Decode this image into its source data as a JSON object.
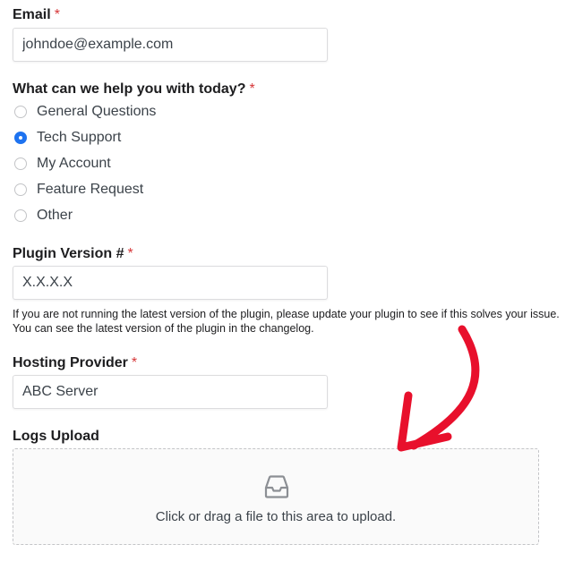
{
  "email": {
    "label": "Email",
    "required_mark": "*",
    "placeholder": "johndoe@example.com"
  },
  "help_topic": {
    "label": "What can we help you with today?",
    "required_mark": "*",
    "options": [
      {
        "label": "General Questions",
        "checked": false
      },
      {
        "label": "Tech Support",
        "checked": true
      },
      {
        "label": "My Account",
        "checked": false
      },
      {
        "label": "Feature Request",
        "checked": false
      },
      {
        "label": "Other",
        "checked": false
      }
    ],
    "selected": "Tech Support"
  },
  "plugin_version": {
    "label": "Plugin Version #",
    "required_mark": "*",
    "placeholder": "X.X.X.X",
    "description": "If you are not running the latest version of the plugin, please update your plugin to see if this solves your issue. You can see the latest version of the plugin in the changelog."
  },
  "hosting_provider": {
    "label": "Hosting Provider",
    "required_mark": "*",
    "value": "ABC Server"
  },
  "logs_upload": {
    "label": "Logs Upload",
    "dropzone_text": "Click or drag a file to this area to upload.",
    "icon": "inbox-tray-icon"
  },
  "colors": {
    "required": "#d63638",
    "radio_checked": "#1e73f0",
    "annotation_arrow": "#e8102c"
  }
}
